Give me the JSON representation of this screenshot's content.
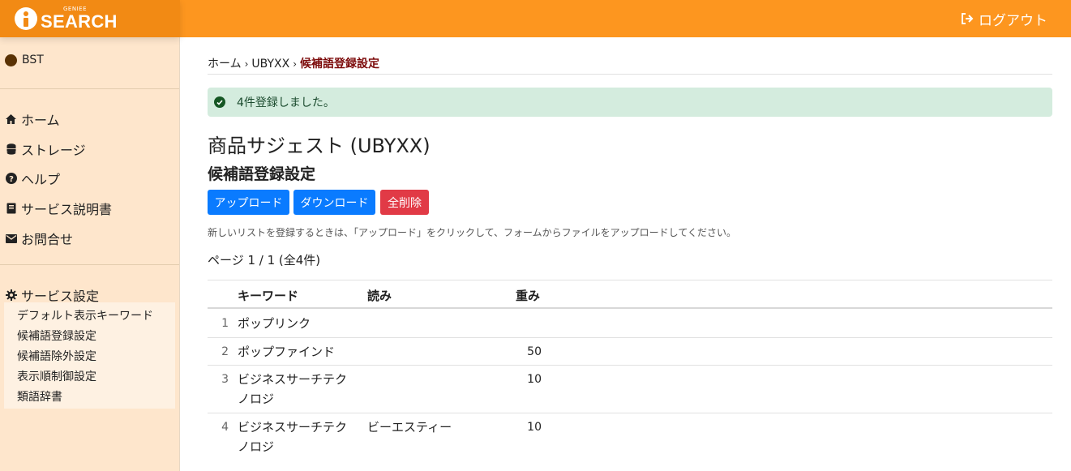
{
  "header": {
    "logo_small": "GENIEE",
    "logo_big": "SEARCH",
    "logout_label": "ログアウト"
  },
  "sidebar": {
    "user": "BST",
    "nav": [
      {
        "label": "ホーム",
        "icon": "home-icon"
      },
      {
        "label": "ストレージ",
        "icon": "database-icon"
      },
      {
        "label": "ヘルプ",
        "icon": "question-circle-icon"
      },
      {
        "label": "サービス説明書",
        "icon": "book-icon"
      },
      {
        "label": "お問合せ",
        "icon": "envelope-icon"
      }
    ],
    "service_settings": {
      "label": "サービス設定",
      "icon": "gear-icon"
    },
    "sub_items": [
      {
        "label": "デフォルト表示キーワード"
      },
      {
        "label": "候補語登録設定"
      },
      {
        "label": "候補語除外設定"
      },
      {
        "label": "表示順制御設定"
      },
      {
        "label": "類語辞書"
      }
    ]
  },
  "breadcrumb": {
    "home": "ホーム",
    "sep": "›",
    "service": "UBYXX",
    "current": "候補語登録設定"
  },
  "alert": {
    "message": "4件登録しました。"
  },
  "page": {
    "title": "商品サジェスト (UBYXX)",
    "subtitle": "候補語登録設定",
    "help_text": "新しいリストを登録するときは、「アップロード」をクリックして、フォームからファイルをアップロードしてください。",
    "page_info": "ページ 1 / 1 (全4件)"
  },
  "buttons": {
    "upload": "アップロード",
    "download": "ダウンロード",
    "delete_all": "全削除"
  },
  "table": {
    "headers": {
      "keyword": "キーワード",
      "reading": "読み",
      "weight": "重み"
    },
    "rows": [
      {
        "index": "1",
        "keyword": "ポップリンク",
        "keyword_line2": "",
        "reading": "",
        "weight": ""
      },
      {
        "index": "2",
        "keyword": "ポップファインド",
        "keyword_line2": "",
        "reading": "",
        "weight": "50"
      },
      {
        "index": "3",
        "keyword": "ビジネスサーチテク",
        "keyword_line2": "ノロジ",
        "reading": "",
        "weight": "10"
      },
      {
        "index": "4",
        "keyword": "ビジネスサーチテク",
        "keyword_line2": "ノロジ",
        "reading": "ビーエスティー",
        "weight": "10"
      }
    ]
  },
  "colors": {
    "header_bg": "#fd961f",
    "sidebar_bg": "#fee6cc",
    "primary": "#0a7bff",
    "danger": "#e13a46",
    "alert_bg": "#d4ecde"
  }
}
